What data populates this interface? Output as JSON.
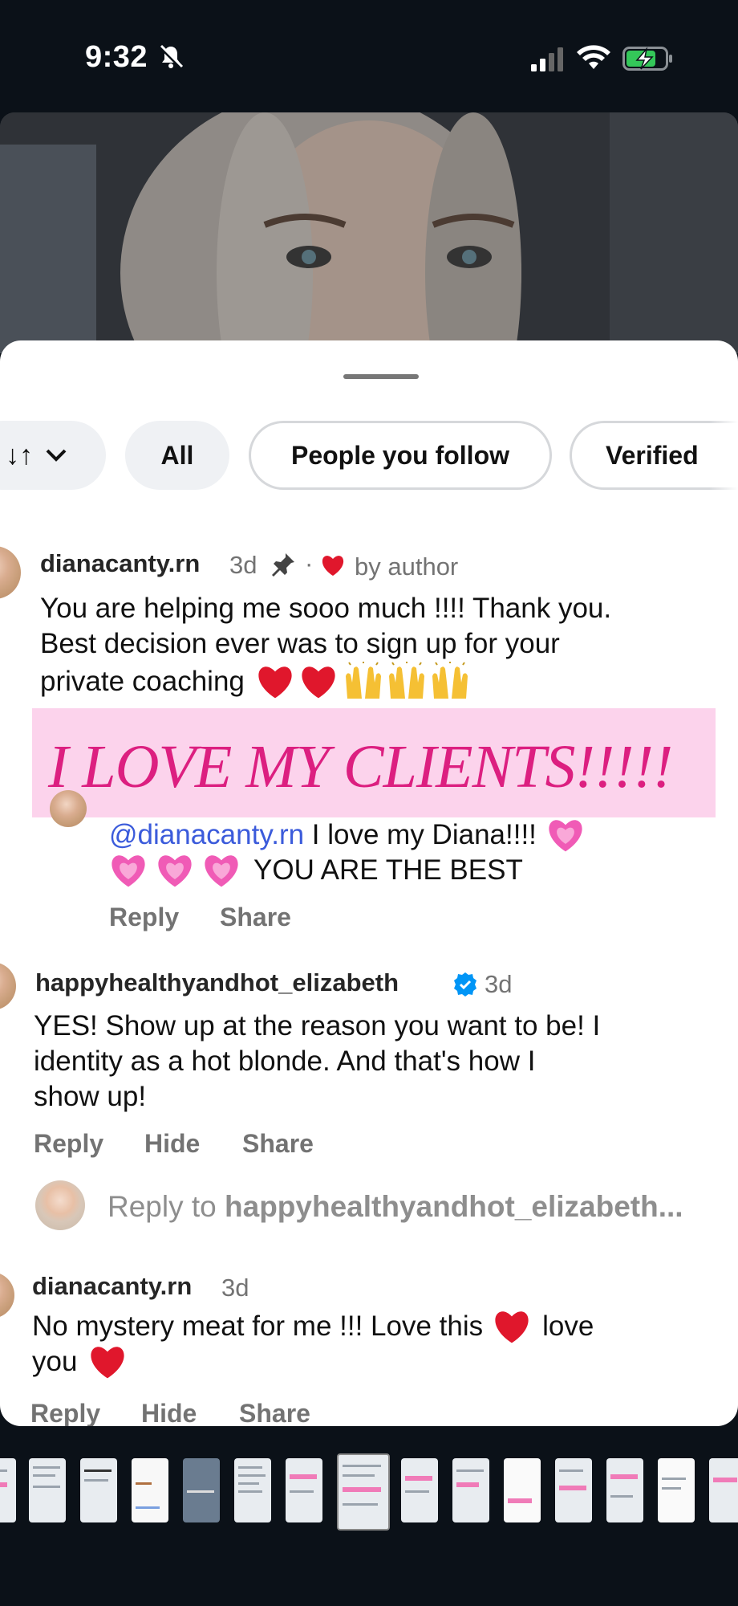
{
  "status": {
    "time": "9:32"
  },
  "filters": {
    "sort_icon_text": "↓↑",
    "all": "All",
    "people_you_follow": "People you follow",
    "verified": "Verified"
  },
  "comment1": {
    "username": "dianacanty.rn",
    "age": "3d",
    "liked_by": "by author",
    "text_lines": [
      "You are helping me sooo much !!!! Thank you.",
      "Best decision ever was to sign up for your",
      "private coaching"
    ],
    "emojis": [
      "heart",
      "heart",
      "raised-hands",
      "raised-hands",
      "raised-hands"
    ]
  },
  "banner": {
    "text": "I LOVE MY CLIENTS!!!!!"
  },
  "reply1": {
    "mention": "@dianacanty.rn",
    "text_a": " I love my Diana!!!!",
    "text_b": "YOU ARE THE BEST",
    "reply_label": "Reply",
    "share_label": "Share"
  },
  "comment2": {
    "username": "happyhealthyandhot_elizabeth",
    "age": "3d",
    "text_lines": [
      "YES! Show up at the reason you want to be! I",
      "identity as a hot blonde. And that's how I",
      "show up!"
    ],
    "reply_label": "Reply",
    "hide_label": "Hide",
    "share_label": "Share"
  },
  "reply_box": {
    "prefix": "Reply to ",
    "target": "happyhealthyandhot_elizabeth..."
  },
  "comment3": {
    "username": "dianacanty.rn",
    "age": "3d",
    "text_a": "No mystery meat for me !!! Love this",
    "text_b": "love",
    "text_c": "you",
    "reply_label": "Reply",
    "hide_label": "Hide",
    "share_label": "Share"
  },
  "colors": {
    "heart": "#e0172c",
    "pink_heart": "#f05bb6",
    "verified_blue": "#0095f6",
    "banner_bg": "#fcd3ec",
    "banner_text": "#dc1f80",
    "mention": "#3b5bdb"
  }
}
